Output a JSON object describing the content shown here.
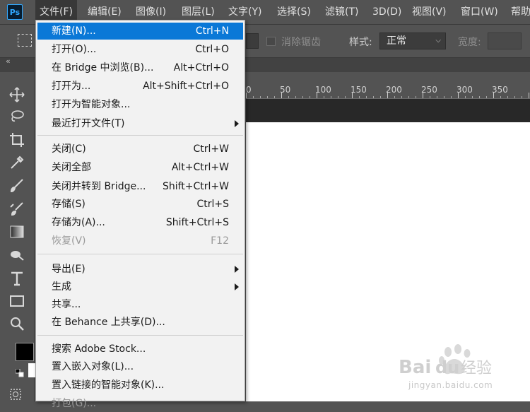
{
  "menubar": {
    "logo": "Ps",
    "items": [
      {
        "label": "文件(F)",
        "active": true
      },
      {
        "label": "编辑(E)"
      },
      {
        "label": "图像(I)"
      },
      {
        "label": "图层(L)"
      },
      {
        "label": "文字(Y)"
      },
      {
        "label": "选择(S)"
      },
      {
        "label": "滤镜(T)"
      },
      {
        "label": "3D(D)"
      },
      {
        "label": "视图(V)"
      },
      {
        "label": "窗口(W)"
      },
      {
        "label": "帮助"
      }
    ]
  },
  "options": {
    "antialias_label": "消除锯齿",
    "style_label": "样式:",
    "style_value": "正常",
    "width_label": "宽度:"
  },
  "ruler": {
    "ticks": [
      "0",
      "50",
      "100",
      "150",
      "200",
      "250",
      "300",
      "350"
    ]
  },
  "file_menu": {
    "groups": [
      [
        {
          "label": "新建(N)...",
          "shortcut": "Ctrl+N",
          "highlighted": true
        },
        {
          "label": "打开(O)...",
          "shortcut": "Ctrl+O"
        },
        {
          "label": "在 Bridge 中浏览(B)...",
          "shortcut": "Alt+Ctrl+O"
        },
        {
          "label": "打开为...",
          "shortcut": "Alt+Shift+Ctrl+O"
        },
        {
          "label": "打开为智能对象...",
          "shortcut": ""
        },
        {
          "label": "最近打开文件(T)",
          "shortcut": "",
          "submenu": true
        }
      ],
      [
        {
          "label": "关闭(C)",
          "shortcut": "Ctrl+W"
        },
        {
          "label": "关闭全部",
          "shortcut": "Alt+Ctrl+W"
        },
        {
          "label": "关闭并转到 Bridge...",
          "shortcut": "Shift+Ctrl+W"
        },
        {
          "label": "存储(S)",
          "shortcut": "Ctrl+S"
        },
        {
          "label": "存储为(A)...",
          "shortcut": "Shift+Ctrl+S"
        },
        {
          "label": "恢复(V)",
          "shortcut": "F12",
          "disabled": true
        }
      ],
      [
        {
          "label": "导出(E)",
          "shortcut": "",
          "submenu": true
        },
        {
          "label": "生成",
          "shortcut": "",
          "submenu": true
        },
        {
          "label": "共享...",
          "shortcut": ""
        },
        {
          "label": "在 Behance 上共享(D)...",
          "shortcut": ""
        }
      ],
      [
        {
          "label": "搜索 Adobe Stock...",
          "shortcut": ""
        },
        {
          "label": "置入嵌入对象(L)...",
          "shortcut": ""
        },
        {
          "label": "置入链接的智能对象(K)...",
          "shortcut": ""
        },
        {
          "label": "打包(G)...",
          "shortcut": "",
          "disabled": true
        }
      ]
    ]
  },
  "watermark": {
    "brand": "Bai du 经验",
    "url": "jingyan.baidu.com"
  },
  "colors": {
    "highlight": "#0a78d7",
    "ps_blue": "#31a8ff",
    "ui_bg": "#535353"
  }
}
